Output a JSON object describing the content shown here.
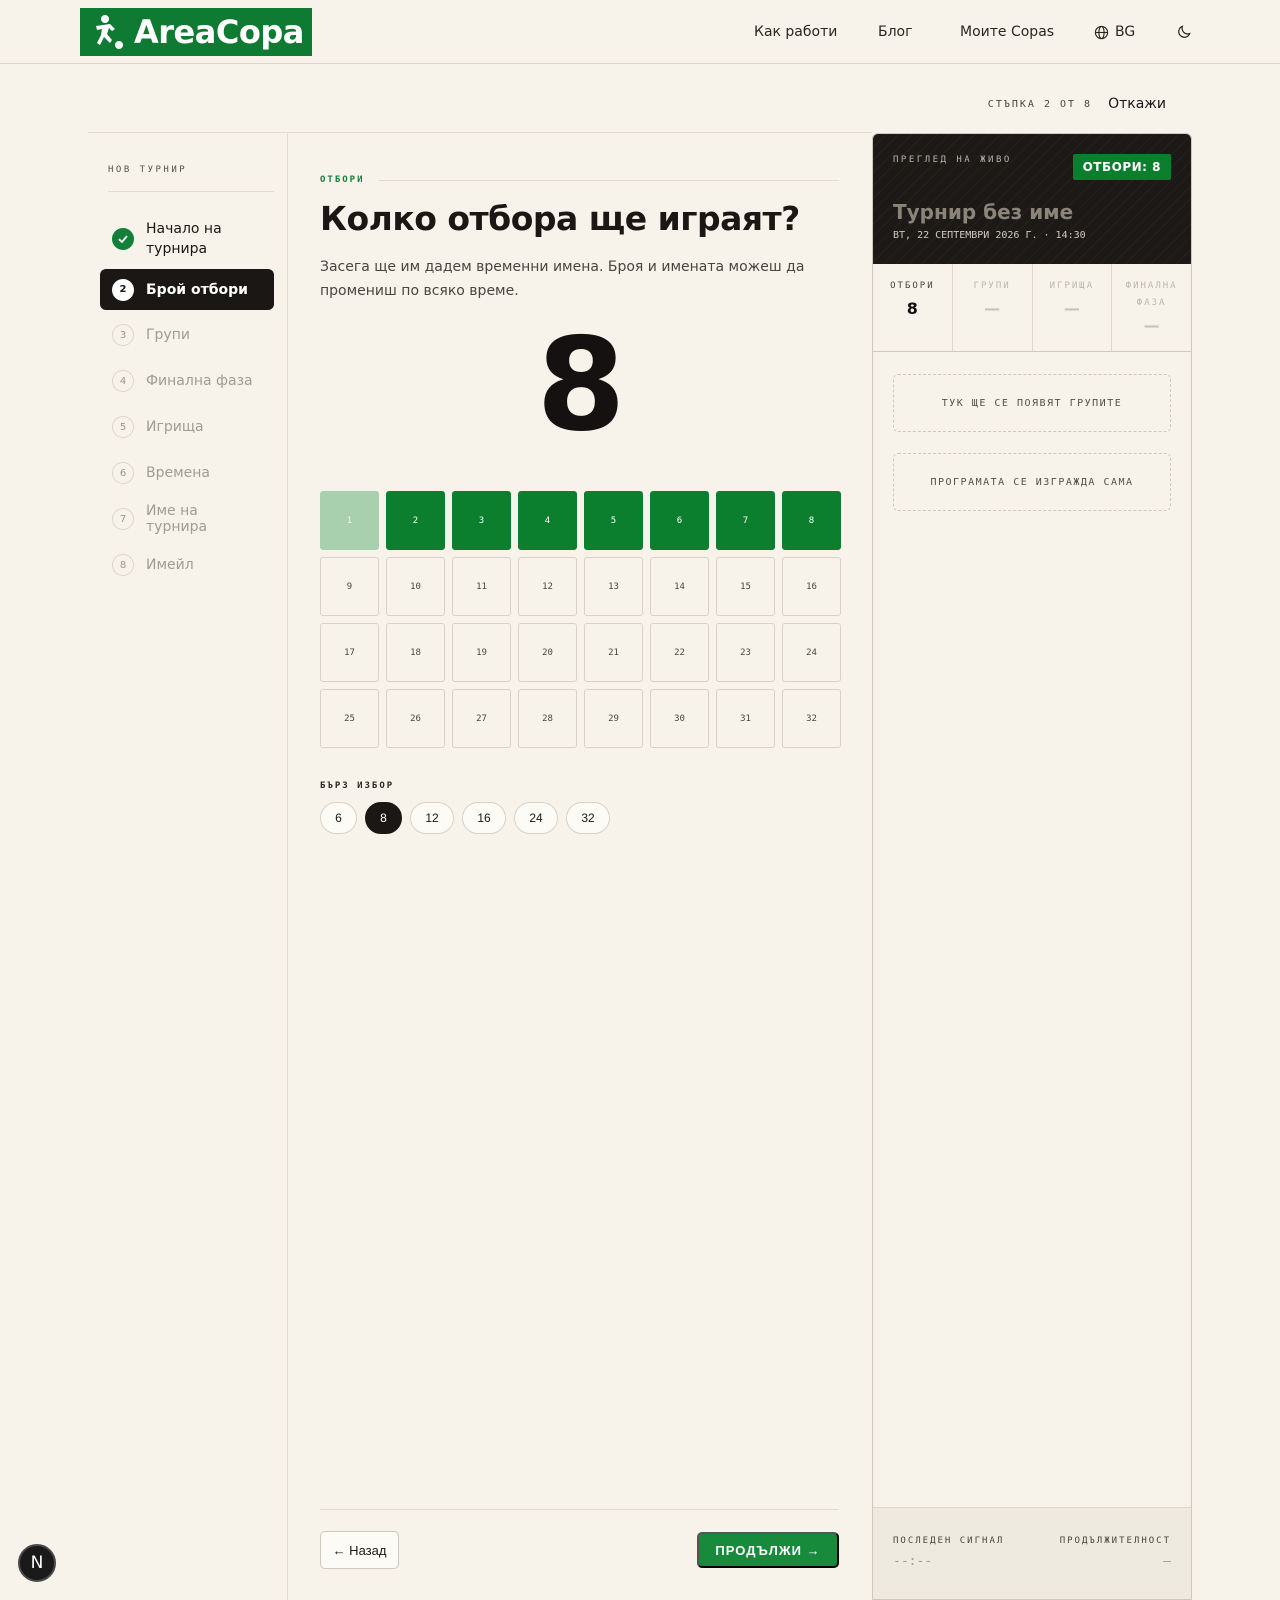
{
  "brand": {
    "name": "AreaCopa",
    "color": "#0f7a32"
  },
  "nav": {
    "how_it_works": "Как работи",
    "blog": "Блог",
    "my_copas": "Моите Copas",
    "language": "BG"
  },
  "stepbar": {
    "counter": "СТЪПКА 2 ОТ 8",
    "cancel": "Откажи"
  },
  "sidebar": {
    "title": "НОВ ТУРНИР",
    "steps": [
      {
        "num": "1",
        "label": "Начало на турнира",
        "state": "done"
      },
      {
        "num": "2",
        "label": "Брой отбори",
        "state": "active"
      },
      {
        "num": "3",
        "label": "Групи",
        "state": "pending"
      },
      {
        "num": "4",
        "label": "Финална фаза",
        "state": "pending"
      },
      {
        "num": "5",
        "label": "Игрища",
        "state": "pending"
      },
      {
        "num": "6",
        "label": "Времена",
        "state": "pending"
      },
      {
        "num": "7",
        "label": "Име на турнира",
        "state": "pending"
      },
      {
        "num": "8",
        "label": "Имейл",
        "state": "pending"
      }
    ]
  },
  "main": {
    "kicker": "ОТБОРИ",
    "title": "Колко отбора ще играят?",
    "subtitle": "Засега ще им дадем временни имена. Броя и имената можеш да промениш по всяко време.",
    "count": "8",
    "grid_max": 32,
    "selected": 8,
    "quick_label": "БЪРЗ ИЗБОР",
    "quick": [
      "6",
      "8",
      "12",
      "16",
      "24",
      "32"
    ],
    "quick_selected": "8",
    "back": "← Назад",
    "next": "ПРОДЪЛЖИ →"
  },
  "panel": {
    "live_label": "ПРЕГЛЕД НА ЖИВО",
    "badge": "ОТБОРИ: 8",
    "tournament_name": "Турнир без име",
    "date": "ВТ, 22 СЕПТЕМВРИ 2026 Г. · 14:30",
    "stats": [
      {
        "label": "ОТБОРИ",
        "value": "8"
      },
      {
        "label": "ГРУПИ",
        "value": "—"
      },
      {
        "label": "ИГРИЩА",
        "value": "—"
      },
      {
        "label": "ФИНАЛНА ФАЗА",
        "value": "—"
      }
    ],
    "groups_placeholder": "ТУК ЩЕ СЕ ПОЯВЯТ ГРУПИТЕ",
    "schedule_placeholder": "ПРОГРАМАТА СЕ ИЗГРАЖДА САМА",
    "last_signal_label": "ПОСЛЕДЕН СИГНАЛ",
    "last_signal_value": "--:--",
    "duration_label": "ПРОДЪЛЖИТЕЛНОСТ",
    "duration_value": "—"
  },
  "dev_badge": "N"
}
